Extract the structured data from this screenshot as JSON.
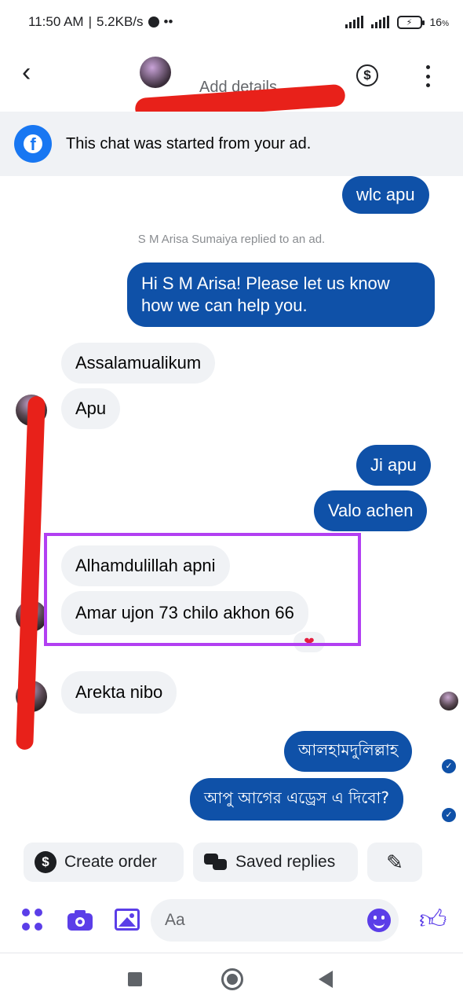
{
  "status_bar": {
    "time": "11:50 AM",
    "net_speed": "5.2KB/s",
    "more": "••",
    "battery": "16",
    "battery_unit": "%"
  },
  "header": {
    "subtitle": "Add details",
    "dollar": "$"
  },
  "ad_banner": {
    "text": "This chat was started from your ad."
  },
  "messages": {
    "m1": "wlc apu",
    "system": "S M Arisa Sumaiya replied to an ad.",
    "m2_line1": "Hi S M Arisa! Please let us know",
    "m2_line2": "how we can help you.",
    "m3": "Assalamualikum",
    "m4": "Apu",
    "m5": "Ji apu",
    "m6": "Valo achen",
    "m7": "Alhamdulillah apni",
    "m8": "Amar ujon 73 chilo akhon 66",
    "m9": "Arekta nibo",
    "m10": "আলহামদুলিল্লাহ",
    "m11": "আপু আগের এড্রেস এ দিবো?"
  },
  "reaction": "❤",
  "actions": {
    "create_order": "Create order",
    "saved_replies": "Saved replies"
  },
  "composer": {
    "placeholder": "Aa"
  },
  "colors": {
    "outgoing_bubble": "#0f51a8",
    "incoming_bubble": "#f0f2f5",
    "accent": "#5b3ee8",
    "highlight_box": "#b23ff2",
    "redaction": "#e8211a"
  }
}
